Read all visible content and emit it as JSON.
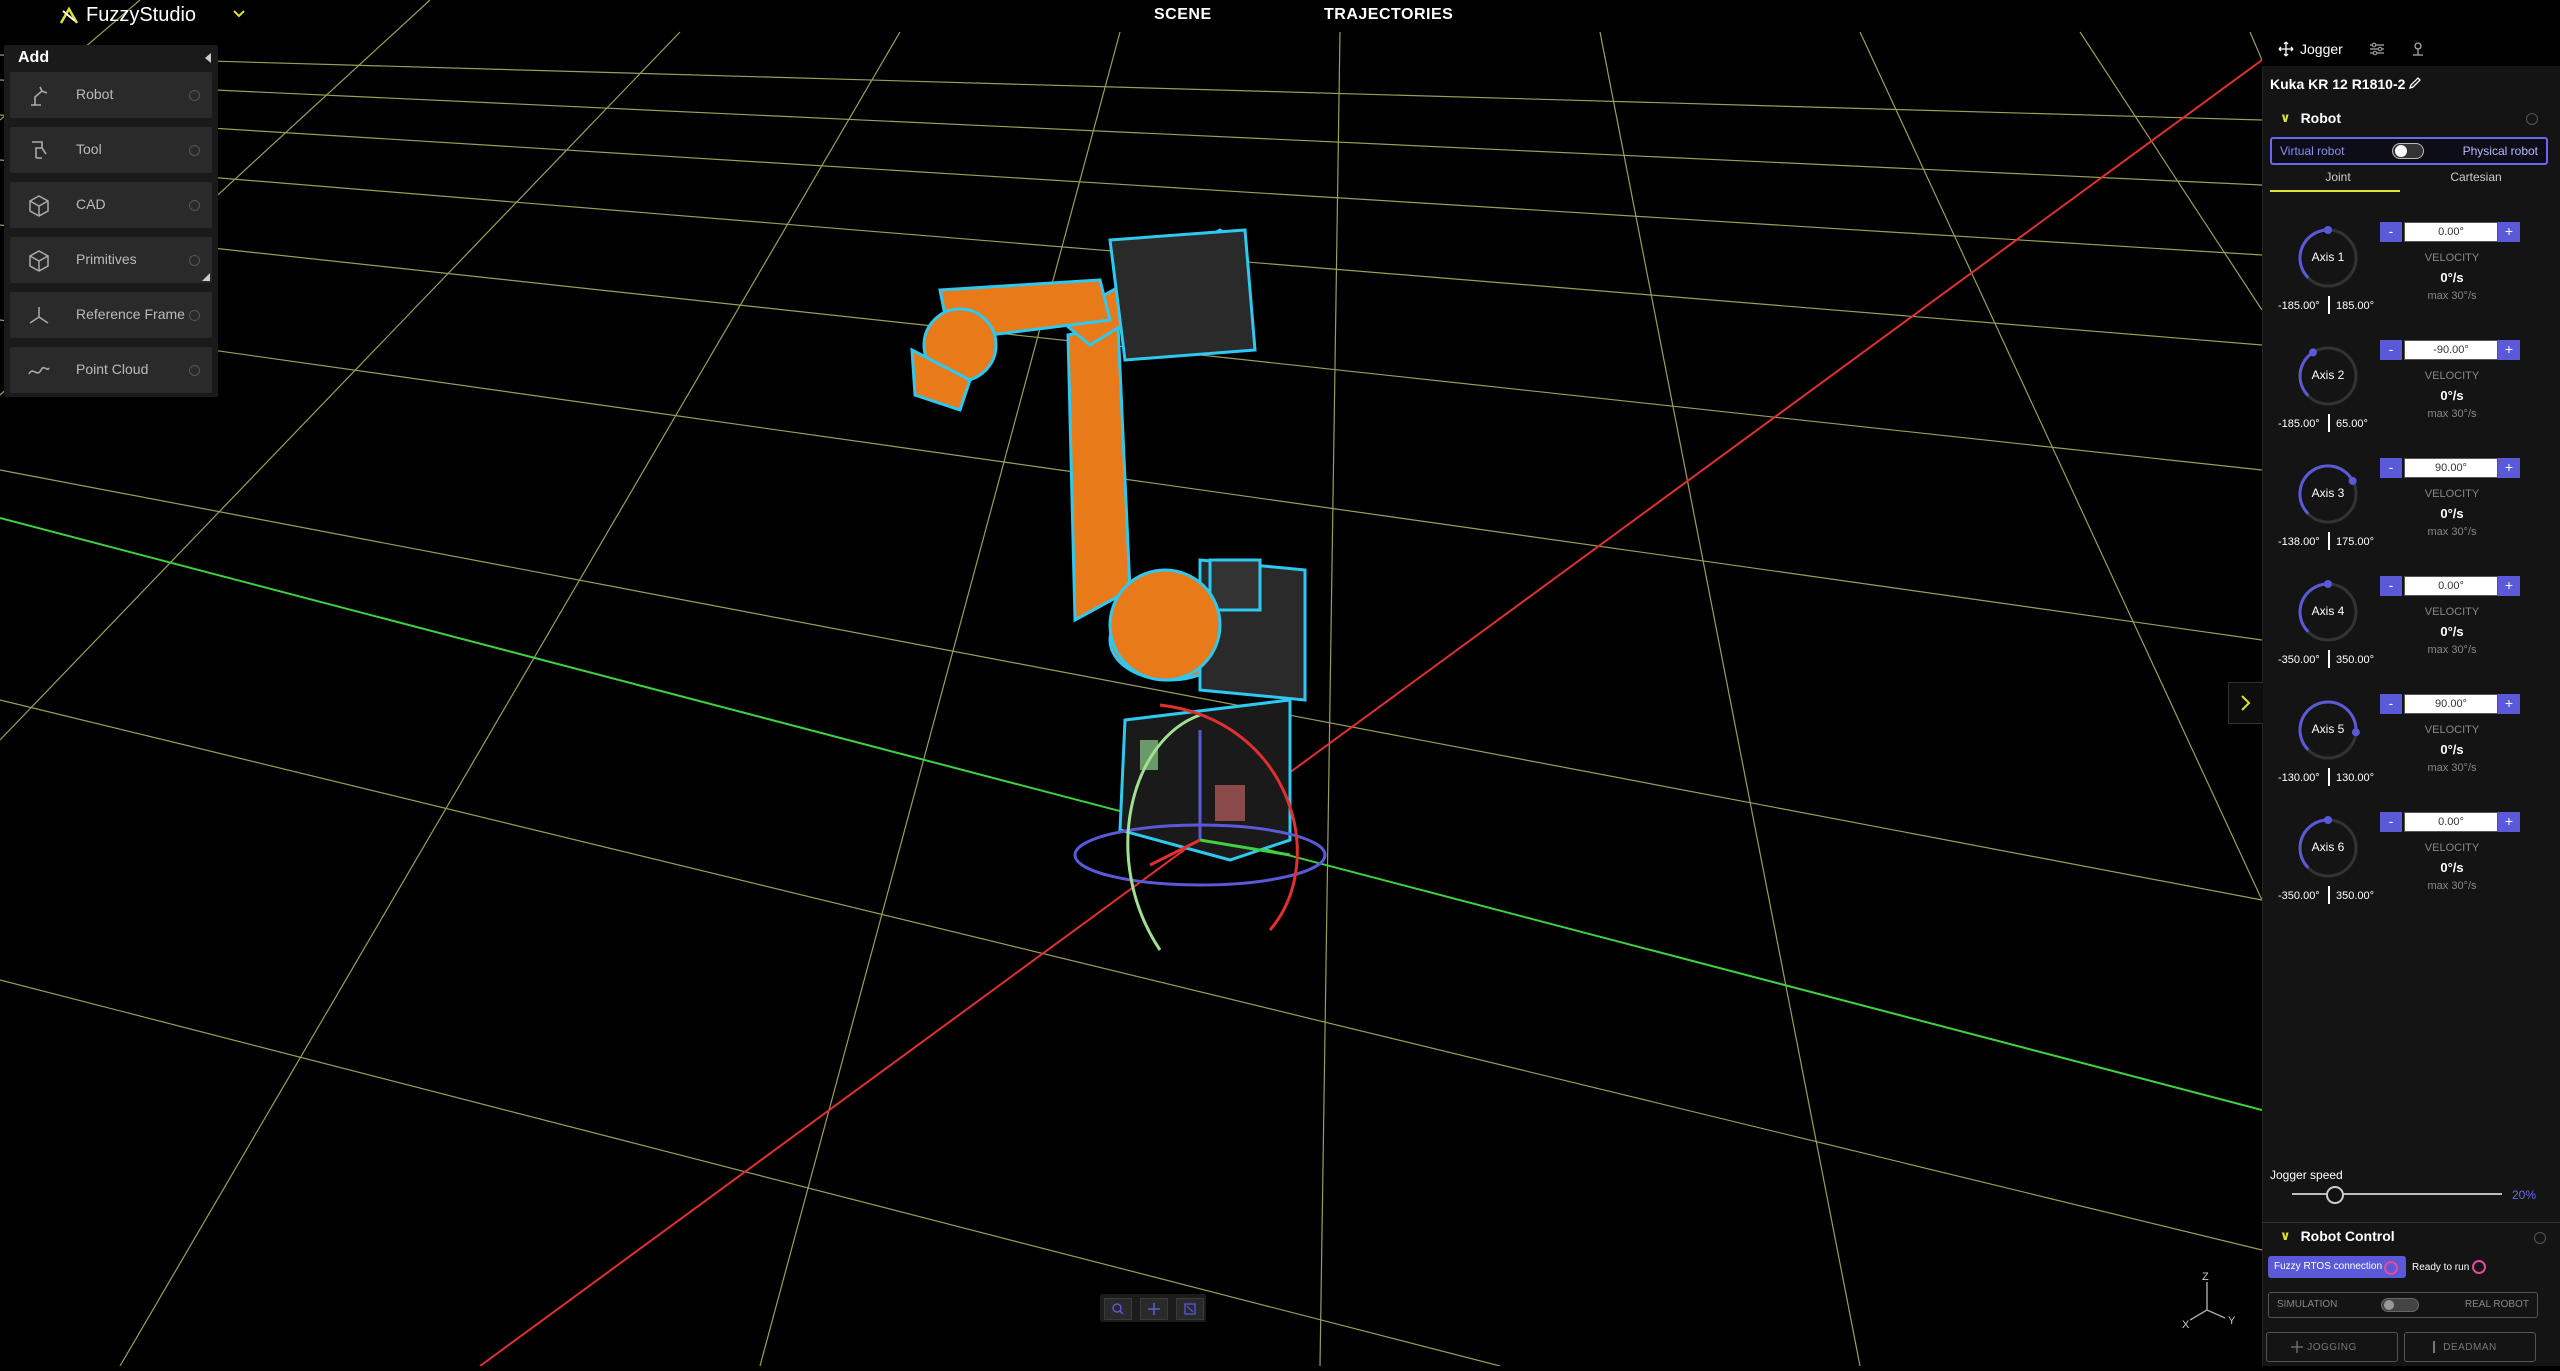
{
  "app": {
    "brand": "FuzzyStudio"
  },
  "topnav": {
    "scene": "SCENE",
    "trajectories": "TRAJECTORIES"
  },
  "add_panel": {
    "title": "Add",
    "items": [
      {
        "label": "Robot",
        "icon": "robot-arm-icon"
      },
      {
        "label": "Tool",
        "icon": "tool-icon"
      },
      {
        "label": "CAD",
        "icon": "cube-icon"
      },
      {
        "label": "Primitives",
        "icon": "primitives-cube-icon"
      },
      {
        "label": "Reference Frame",
        "icon": "reference-frame-icon"
      },
      {
        "label": "Point Cloud",
        "icon": "point-cloud-icon"
      }
    ]
  },
  "right_panel": {
    "tabs": {
      "jogger": "Jogger"
    },
    "robot_name": "Kuka KR 12 R1810-2",
    "robot_section": "Robot",
    "virtual_robot": "Virtual robot",
    "physical_robot": "Physical robot",
    "joint_tab": "Joint",
    "cartesian_tab": "Cartesian",
    "velocity_label": "VELOCITY",
    "axes": [
      {
        "name": "Axis 1",
        "value": "0.00°",
        "min": "-185.00°",
        "max": "185.00°",
        "velocity": "0°/s",
        "max_vel": "max 30°/s",
        "fraction": 0.5
      },
      {
        "name": "Axis 2",
        "value": "-90.00°",
        "min": "-185.00°",
        "max": "65.00°",
        "velocity": "0°/s",
        "max_vel": "max 30°/s",
        "fraction": 0.38
      },
      {
        "name": "Axis 3",
        "value": "90.00°",
        "min": "-138.00°",
        "max": "175.00°",
        "velocity": "0°/s",
        "max_vel": "max 30°/s",
        "fraction": 0.73
      },
      {
        "name": "Axis 4",
        "value": "0.00°",
        "min": "-350.00°",
        "max": "350.00°",
        "velocity": "0°/s",
        "max_vel": "max 30°/s",
        "fraction": 0.5
      },
      {
        "name": "Axis 5",
        "value": "90.00°",
        "min": "-130.00°",
        "max": "130.00°",
        "velocity": "0°/s",
        "max_vel": "max 30°/s",
        "fraction": 0.85
      },
      {
        "name": "Axis 6",
        "value": "0.00°",
        "min": "-350.00°",
        "max": "350.00°",
        "velocity": "0°/s",
        "max_vel": "max 30°/s",
        "fraction": 0.5
      }
    ],
    "jogger_speed_label": "Jogger speed",
    "jogger_speed_value": "20%",
    "jogger_speed_fraction": 0.2,
    "robot_control": {
      "title": "Robot Control",
      "rtos": "Fuzzy RTOS connection",
      "ready": "Ready to run",
      "simulation": "SIMULATION",
      "real_robot": "REAL ROBOT",
      "jogging": "JOGGING",
      "deadman": "DEADMAN"
    }
  },
  "gizmo": {
    "z": "Z",
    "x": "X",
    "y": "Y"
  },
  "colors": {
    "accent": "#5a5ad8",
    "robot": "#e87a1a",
    "outline": "#2ec8f0",
    "x_axis": "#e03030",
    "y_axis": "#40d040",
    "grid": "#c8c86a"
  }
}
